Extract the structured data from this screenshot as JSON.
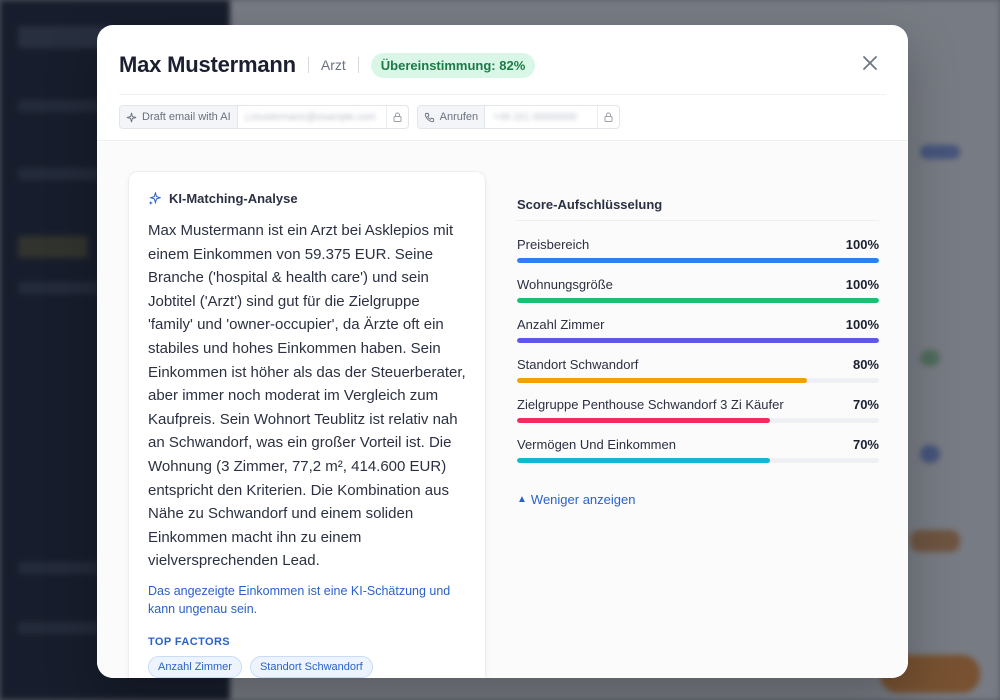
{
  "header": {
    "name": "Max Mustermann",
    "role": "Arzt",
    "match_badge": "Übereinstimmung: 82%"
  },
  "contact": {
    "email_action": "Draft email with AI",
    "email_value": "j.mustermann@example.com",
    "phone_action": "Anrufen",
    "phone_value": "+49 151 00000000"
  },
  "analysis": {
    "title": "KI-Matching-Analyse",
    "text": "Max Mustermann ist ein Arzt bei Asklepios mit einem Einkommen von 59.375 EUR. Seine Branche ('hospital & health care') und sein Jobtitel ('Arzt') sind gut für die Zielgruppe 'family' und 'owner-occupier', da Ärzte oft ein stabiles und hohes Einkommen haben. Sein Einkommen ist höher als das der Steuerberater, aber immer noch moderat im Vergleich zum Kaufpreis. Sein Wohnort Teublitz ist relativ nah an Schwandorf, was ein großer Vorteil ist. Die Wohnung (3 Zimmer, 77,2 m², 414.600 EUR) entspricht den Kriterien. Die Kombination aus Nähe zu Schwandorf und einem soliden Einkommen macht ihn zu einem vielversprechenden Lead.",
    "disclaimer": "Das angezeigte Einkommen ist eine KI-Schätzung und kann ungenau sein.",
    "top_factors_label": "TOP FACTORS",
    "top_factors": [
      "Anzahl Zimmer",
      "Standort Schwandorf"
    ]
  },
  "scores": {
    "heading": "Score-Aufschlüsselung",
    "items": [
      {
        "label": "Preisbereich",
        "value": "100%",
        "percent": 100,
        "color": "#2f7ff0"
      },
      {
        "label": "Wohnungsgröße",
        "value": "100%",
        "percent": 100,
        "color": "#1dbf73"
      },
      {
        "label": "Anzahl Zimmer",
        "value": "100%",
        "percent": 100,
        "color": "#5f58e6"
      },
      {
        "label": "Standort Schwandorf",
        "value": "80%",
        "percent": 80,
        "color": "#f59e0b"
      },
      {
        "label": "Zielgruppe Penthouse Schwandorf 3 Zi Käufer",
        "value": "70%",
        "percent": 70,
        "color": "#ef2d5e"
      },
      {
        "label": "Vermögen Und Einkommen",
        "value": "70%",
        "percent": 70,
        "color": "#12b8cf"
      }
    ],
    "show_less": "Weniger anzeigen"
  },
  "icons": {
    "close": "close-icon",
    "sparkle": "sparkle-icon",
    "phone": "phone-icon",
    "lock": "lock-icon"
  },
  "colors": {
    "badge_bg": "#d9f6e6",
    "badge_text": "#1d7a48",
    "link": "#2a62c9"
  }
}
